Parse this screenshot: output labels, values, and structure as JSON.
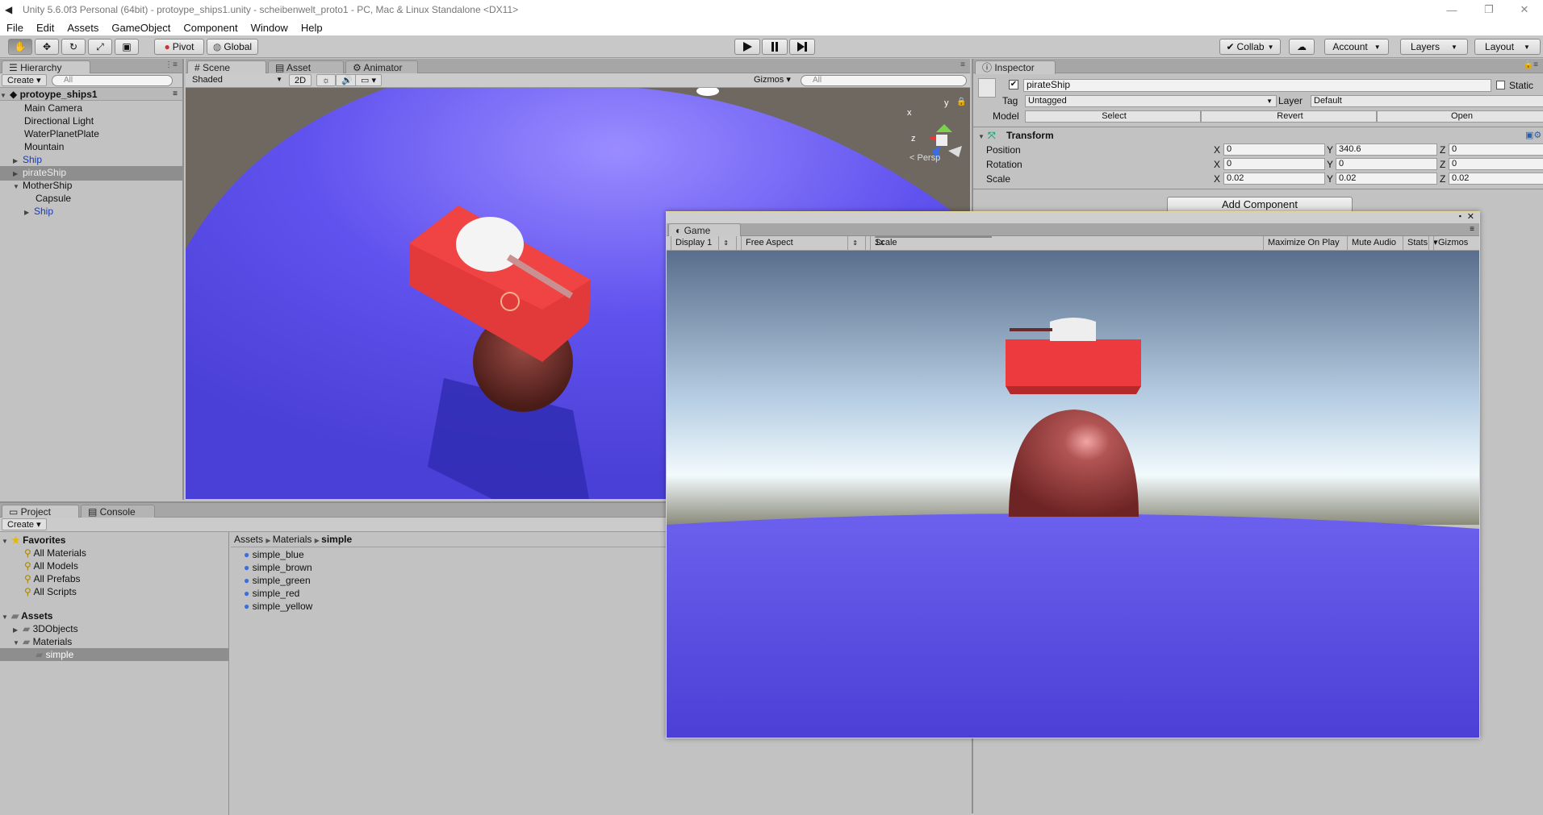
{
  "window": {
    "title": "Unity 5.6.0f3 Personal (64bit) - protoype_ships1.unity - scheibenwelt_proto1 - PC, Mac & Linux Standalone <DX11>"
  },
  "menu": [
    "File",
    "Edit",
    "Assets",
    "GameObject",
    "Component",
    "Window",
    "Help"
  ],
  "toolbar": {
    "pivot": "Pivot",
    "global": "Global",
    "collab": "Collab",
    "account": "Account",
    "layers": "Layers",
    "layout": "Layout"
  },
  "hierarchy": {
    "tab": "Hierarchy",
    "create": "Create",
    "search_placeholder": "All",
    "scene": "protoype_ships1",
    "items": [
      {
        "label": "Main Camera"
      },
      {
        "label": "Directional Light"
      },
      {
        "label": "WaterPlanetPlate"
      },
      {
        "label": "Mountain"
      },
      {
        "label": "Ship"
      },
      {
        "label": "pirateShip"
      },
      {
        "label": "MotherShip"
      },
      {
        "label": "Capsule"
      },
      {
        "label": "Ship"
      }
    ]
  },
  "scene": {
    "tabs": [
      "Scene",
      "Asset Store",
      "Animator"
    ],
    "shading": "Shaded",
    "mode2d": "2D",
    "gizmos": "Gizmos",
    "search_placeholder": "All",
    "persp": "< Persp",
    "axis_y": "y",
    "axis_z": "z",
    "axis_x": "x"
  },
  "inspector": {
    "tab": "Inspector",
    "name": "pirateShip",
    "static": "Static",
    "tag_label": "Tag",
    "tag": "Untagged",
    "layer_label": "Layer",
    "layer": "Default",
    "model_label": "Model",
    "select": "Select",
    "revert": "Revert",
    "open": "Open",
    "transform": "Transform",
    "position_label": "Position",
    "rotation_label": "Rotation",
    "scale_label": "Scale",
    "axis_x": "X",
    "axis_y": "Y",
    "axis_z": "Z",
    "position": [
      "0",
      "340.6",
      "0"
    ],
    "rotation": [
      "0",
      "0",
      "0"
    ],
    "scale": [
      "0.02",
      "0.02",
      "0.02"
    ],
    "add_component": "Add Component"
  },
  "project": {
    "tabs": [
      "Project",
      "Console"
    ],
    "create": "Create",
    "favorites": "Favorites",
    "favorite_items": [
      "All Materials",
      "All Models",
      "All Prefabs",
      "All Scripts"
    ],
    "assets": "Assets",
    "folders": [
      "3DObjects",
      "Materials",
      "simple"
    ],
    "breadcrumb": [
      "Assets",
      "Materials",
      "simple"
    ],
    "files": [
      "simple_blue",
      "simple_brown",
      "simple_green",
      "simple_red",
      "simple_yellow"
    ]
  },
  "game": {
    "tab": "Game",
    "display": "Display 1",
    "aspect": "Free Aspect",
    "scale_label": "Scale",
    "scale_value": "1x",
    "maximize": "Maximize On Play",
    "mute": "Mute Audio",
    "stats": "Stats",
    "gizmos": "Gizmos"
  }
}
